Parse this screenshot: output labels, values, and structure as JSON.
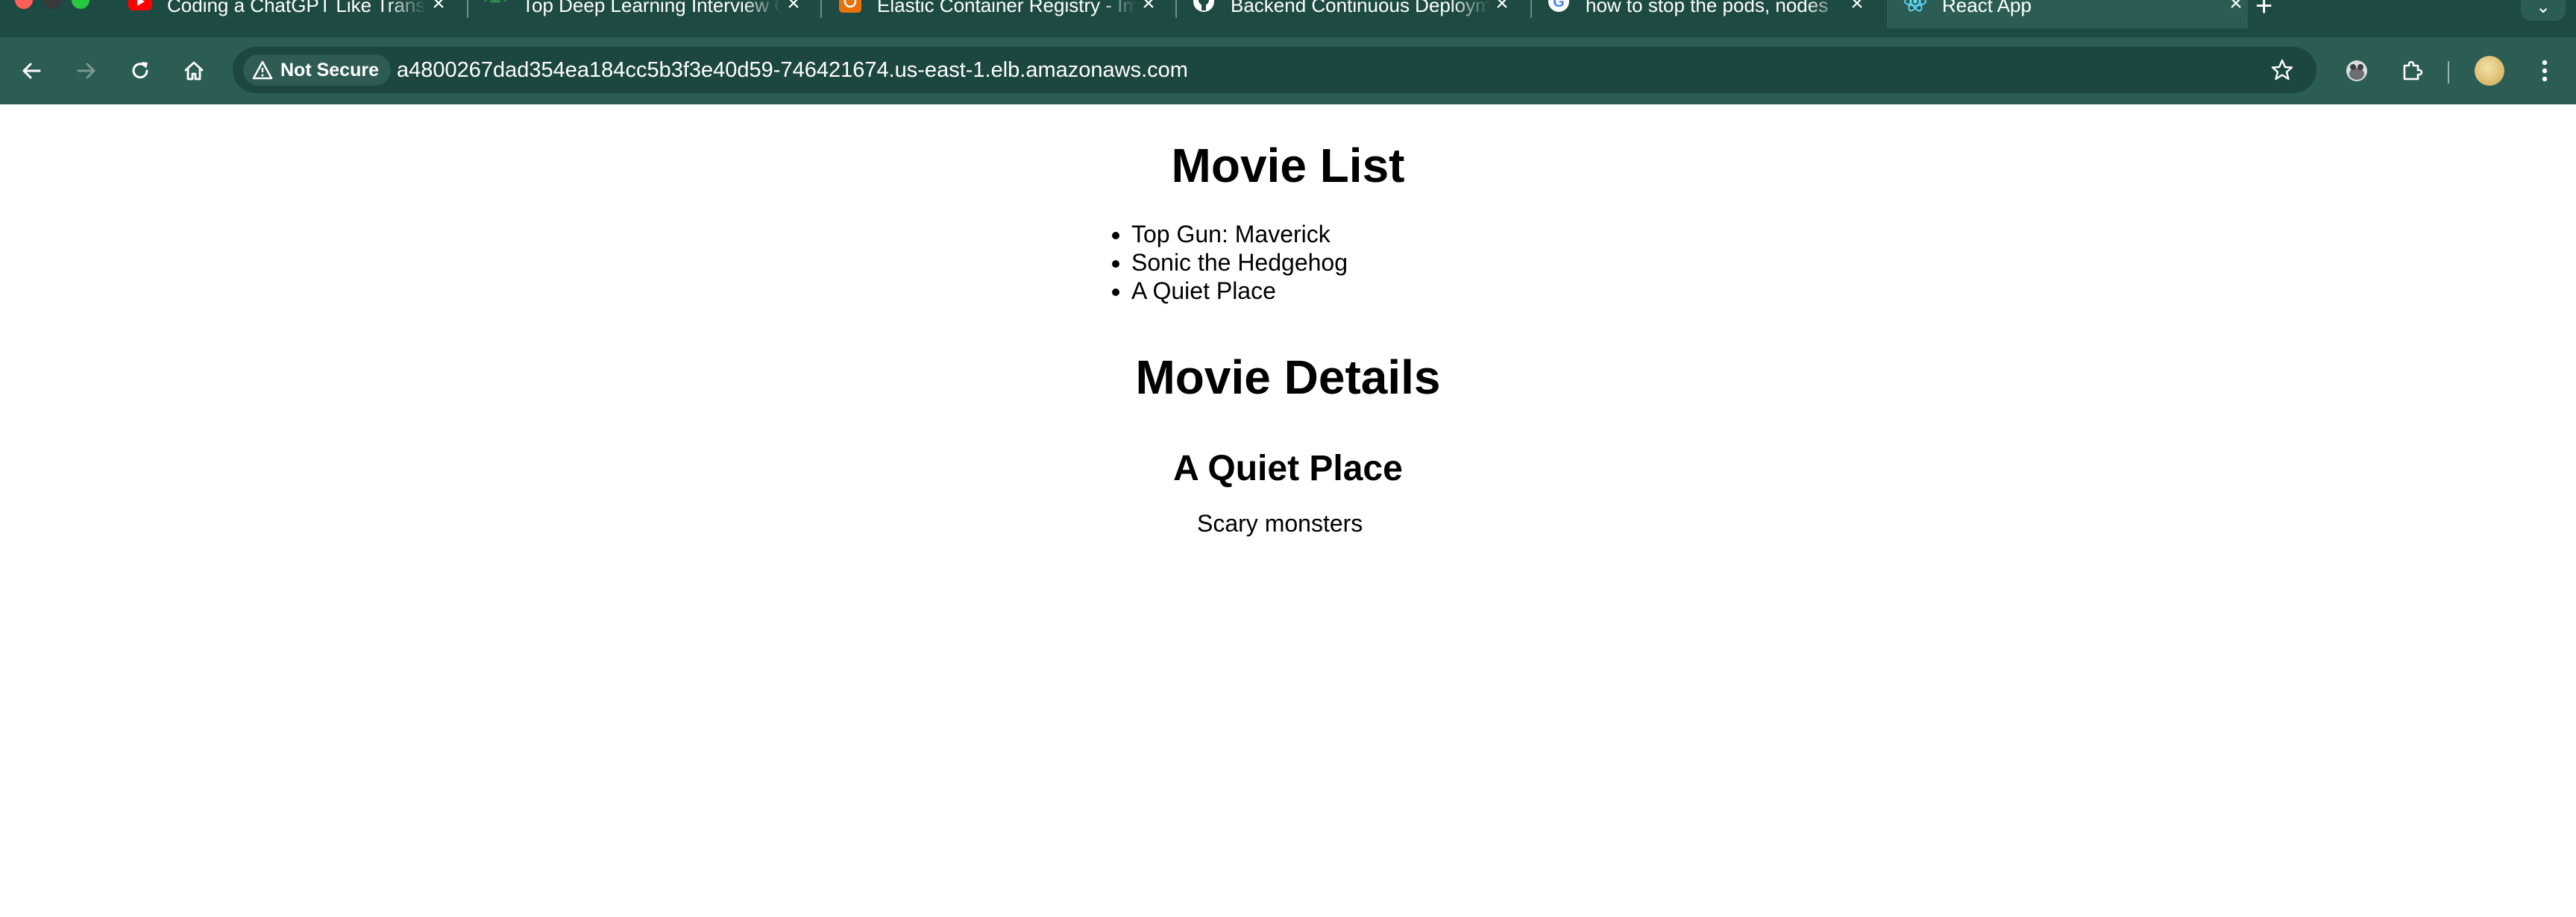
{
  "browser": {
    "tabs": [
      {
        "title": "Coding a ChatGPT Like Transformer",
        "icon": "youtube-icon",
        "icon_color": "#ff0000",
        "active": false
      },
      {
        "title": "Top Deep Learning Interview Questions",
        "icon": "geeksforgeeks-icon",
        "icon_color": "#2f8d46",
        "active": false
      },
      {
        "title": "Elastic Container Registry - Images",
        "icon": "aws-ecr-icon",
        "icon_color": "#e8710a",
        "active": false
      },
      {
        "title": "Backend Continuous Deployment",
        "icon": "github-icon",
        "icon_color": "#ffffff",
        "active": false
      },
      {
        "title": "how to stop the pods, nodes",
        "icon": "google-icon",
        "icon_color": "#4285f4",
        "active": false
      },
      {
        "title": "React App",
        "icon": "react-icon",
        "icon_color": "#61dafb",
        "active": true
      }
    ],
    "new_tab_label": "+",
    "tab_menu_label": "⌄",
    "security_label": "Not Secure",
    "url": "a4800267dad354ea184cc5b3f3e40d59-746421674.us-east-1.elb.amazonaws.com",
    "colors": {
      "tabstrip": "#1d4a42",
      "toolbar": "#2b5d54",
      "omnibox": "#1c4640"
    }
  },
  "page": {
    "list_heading": "Movie List",
    "movies": [
      "Top Gun: Maverick",
      "Sonic the Hedgehog",
      "A Quiet Place"
    ],
    "details_heading": "Movie Details",
    "selected_movie": {
      "title": "A Quiet Place",
      "description": "Scary monsters"
    }
  }
}
